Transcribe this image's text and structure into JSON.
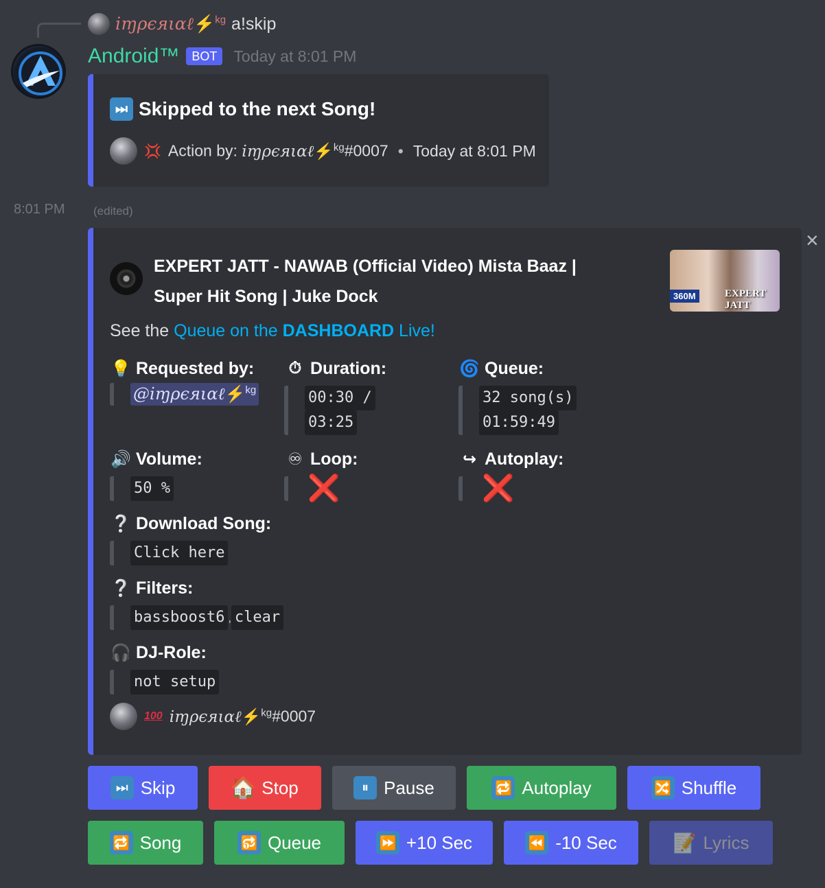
{
  "reply": {
    "username": "iɱρєяιαℓ",
    "bolt": "⚡",
    "suffix": "kg",
    "command": "a!skip"
  },
  "author": {
    "name": "Android™",
    "tag": "BOT",
    "time": "Today at 8:01 PM"
  },
  "embed1": {
    "icon": "⏭",
    "title": "Skipped to the next Song!",
    "footer_prefix": "Action by: ",
    "footer_user": "iɱρєяιαℓ",
    "footer_suffix": "kg",
    "footer_discrim": "#0007",
    "footer_sep": "•",
    "footer_time": "Today at 8:01 PM"
  },
  "second": {
    "time": "8:01 PM",
    "edited": "(edited)",
    "close": "×"
  },
  "embed2": {
    "title": "EXPERT JATT - NAWAB (Official Video) Mista Baaz | Super Hit Song | Juke Dock",
    "thumbnail": {
      "views_badge": "360M",
      "caption": "EXPERT JATT"
    },
    "description": {
      "prefix": "See the ",
      "link1": "Queue on the ",
      "link_bold": "DASHBOARD",
      "link2": " Live!"
    },
    "fields": {
      "requested": {
        "icon": "💡",
        "name": "Requested by:",
        "mention": "@iɱρєяιαℓ",
        "mention_suffix": "kg"
      },
      "duration": {
        "icon": "⏱",
        "name": "Duration:",
        "line1": "00:30 /",
        "line2": "03:25"
      },
      "queue": {
        "icon": "🌀",
        "name": "Queue:",
        "line1": "32 song(s)",
        "line2": "01:59:49"
      },
      "volume": {
        "icon": "🔊",
        "name": "Volume:",
        "value": "50 %"
      },
      "loop": {
        "icon": "♾",
        "name": "Loop:",
        "value": "❌"
      },
      "autoplay": {
        "icon": "↪",
        "name": "Autoplay:",
        "value": "❌"
      },
      "download": {
        "icon": "❔",
        "name": "Download Song:",
        "value": "Click here"
      },
      "filters": {
        "icon": "❔",
        "name": "Filters:",
        "value1": "bassboost6",
        "sep": ",",
        "value2": "clear"
      },
      "djrole": {
        "icon": "🎧",
        "name": "DJ-Role:",
        "value": "not setup"
      }
    },
    "footer": {
      "badge": "100",
      "user": "iɱρєяιαℓ",
      "suffix": "kg",
      "discrim": "#0007"
    }
  },
  "buttons_row1": [
    {
      "icon": "⏭",
      "label": "Skip",
      "style": "blurple"
    },
    {
      "icon": "🏠",
      "label": "Stop",
      "style": "red"
    },
    {
      "icon": "⏸",
      "label": "Pause",
      "style": "grey"
    },
    {
      "icon": "🔁",
      "label": "Autoplay",
      "style": "green"
    },
    {
      "icon": "🔀",
      "label": "Shuffle",
      "style": "blurple"
    }
  ],
  "buttons_row2": [
    {
      "icon": "🔁",
      "label": "Song",
      "style": "green"
    },
    {
      "icon": "🔂",
      "label": "Queue",
      "style": "green"
    },
    {
      "icon": "⏩",
      "label": "+10 Sec",
      "style": "blurple"
    },
    {
      "icon": "⏪",
      "label": "-10 Sec",
      "style": "blurple"
    },
    {
      "icon": "📝",
      "label": "Lyrics",
      "style": "disabled"
    }
  ],
  "colors": {
    "background": "#36393f",
    "embed_bg": "#2f3136",
    "embed_accent": "#5865f2",
    "bot_name": "#3fd9a7",
    "link": "#00aff4",
    "danger": "#ed4245",
    "success": "#3ba55d"
  }
}
